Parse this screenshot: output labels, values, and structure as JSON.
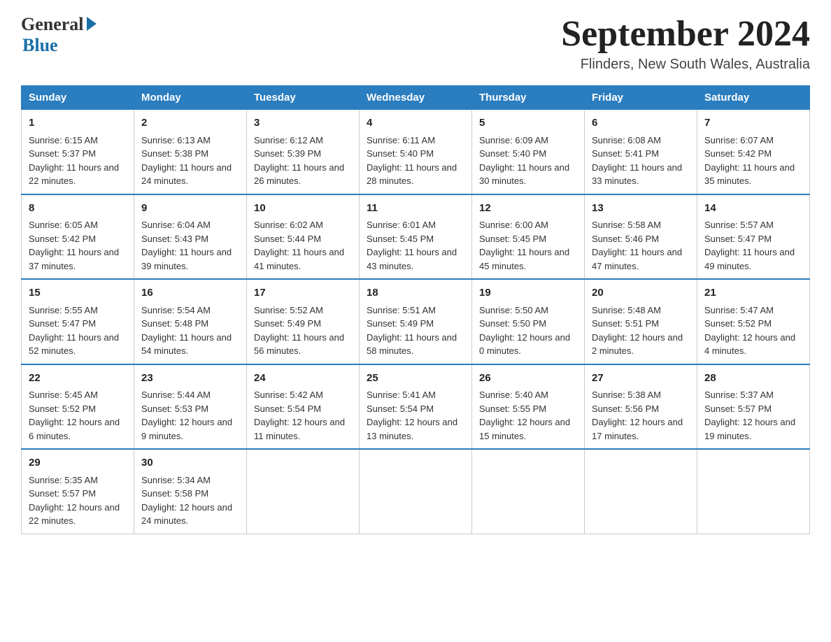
{
  "logo": {
    "general": "General",
    "blue": "Blue"
  },
  "title": {
    "month_year": "September 2024",
    "location": "Flinders, New South Wales, Australia"
  },
  "days_of_week": [
    "Sunday",
    "Monday",
    "Tuesday",
    "Wednesday",
    "Thursday",
    "Friday",
    "Saturday"
  ],
  "weeks": [
    [
      {
        "day": "1",
        "sunrise": "6:15 AM",
        "sunset": "5:37 PM",
        "daylight": "11 hours and 22 minutes."
      },
      {
        "day": "2",
        "sunrise": "6:13 AM",
        "sunset": "5:38 PM",
        "daylight": "11 hours and 24 minutes."
      },
      {
        "day": "3",
        "sunrise": "6:12 AM",
        "sunset": "5:39 PM",
        "daylight": "11 hours and 26 minutes."
      },
      {
        "day": "4",
        "sunrise": "6:11 AM",
        "sunset": "5:40 PM",
        "daylight": "11 hours and 28 minutes."
      },
      {
        "day": "5",
        "sunrise": "6:09 AM",
        "sunset": "5:40 PM",
        "daylight": "11 hours and 30 minutes."
      },
      {
        "day": "6",
        "sunrise": "6:08 AM",
        "sunset": "5:41 PM",
        "daylight": "11 hours and 33 minutes."
      },
      {
        "day": "7",
        "sunrise": "6:07 AM",
        "sunset": "5:42 PM",
        "daylight": "11 hours and 35 minutes."
      }
    ],
    [
      {
        "day": "8",
        "sunrise": "6:05 AM",
        "sunset": "5:42 PM",
        "daylight": "11 hours and 37 minutes."
      },
      {
        "day": "9",
        "sunrise": "6:04 AM",
        "sunset": "5:43 PM",
        "daylight": "11 hours and 39 minutes."
      },
      {
        "day": "10",
        "sunrise": "6:02 AM",
        "sunset": "5:44 PM",
        "daylight": "11 hours and 41 minutes."
      },
      {
        "day": "11",
        "sunrise": "6:01 AM",
        "sunset": "5:45 PM",
        "daylight": "11 hours and 43 minutes."
      },
      {
        "day": "12",
        "sunrise": "6:00 AM",
        "sunset": "5:45 PM",
        "daylight": "11 hours and 45 minutes."
      },
      {
        "day": "13",
        "sunrise": "5:58 AM",
        "sunset": "5:46 PM",
        "daylight": "11 hours and 47 minutes."
      },
      {
        "day": "14",
        "sunrise": "5:57 AM",
        "sunset": "5:47 PM",
        "daylight": "11 hours and 49 minutes."
      }
    ],
    [
      {
        "day": "15",
        "sunrise": "5:55 AM",
        "sunset": "5:47 PM",
        "daylight": "11 hours and 52 minutes."
      },
      {
        "day": "16",
        "sunrise": "5:54 AM",
        "sunset": "5:48 PM",
        "daylight": "11 hours and 54 minutes."
      },
      {
        "day": "17",
        "sunrise": "5:52 AM",
        "sunset": "5:49 PM",
        "daylight": "11 hours and 56 minutes."
      },
      {
        "day": "18",
        "sunrise": "5:51 AM",
        "sunset": "5:49 PM",
        "daylight": "11 hours and 58 minutes."
      },
      {
        "day": "19",
        "sunrise": "5:50 AM",
        "sunset": "5:50 PM",
        "daylight": "12 hours and 0 minutes."
      },
      {
        "day": "20",
        "sunrise": "5:48 AM",
        "sunset": "5:51 PM",
        "daylight": "12 hours and 2 minutes."
      },
      {
        "day": "21",
        "sunrise": "5:47 AM",
        "sunset": "5:52 PM",
        "daylight": "12 hours and 4 minutes."
      }
    ],
    [
      {
        "day": "22",
        "sunrise": "5:45 AM",
        "sunset": "5:52 PM",
        "daylight": "12 hours and 6 minutes."
      },
      {
        "day": "23",
        "sunrise": "5:44 AM",
        "sunset": "5:53 PM",
        "daylight": "12 hours and 9 minutes."
      },
      {
        "day": "24",
        "sunrise": "5:42 AM",
        "sunset": "5:54 PM",
        "daylight": "12 hours and 11 minutes."
      },
      {
        "day": "25",
        "sunrise": "5:41 AM",
        "sunset": "5:54 PM",
        "daylight": "12 hours and 13 minutes."
      },
      {
        "day": "26",
        "sunrise": "5:40 AM",
        "sunset": "5:55 PM",
        "daylight": "12 hours and 15 minutes."
      },
      {
        "day": "27",
        "sunrise": "5:38 AM",
        "sunset": "5:56 PM",
        "daylight": "12 hours and 17 minutes."
      },
      {
        "day": "28",
        "sunrise": "5:37 AM",
        "sunset": "5:57 PM",
        "daylight": "12 hours and 19 minutes."
      }
    ],
    [
      {
        "day": "29",
        "sunrise": "5:35 AM",
        "sunset": "5:57 PM",
        "daylight": "12 hours and 22 minutes."
      },
      {
        "day": "30",
        "sunrise": "5:34 AM",
        "sunset": "5:58 PM",
        "daylight": "12 hours and 24 minutes."
      },
      null,
      null,
      null,
      null,
      null
    ]
  ],
  "labels": {
    "sunrise": "Sunrise:",
    "sunset": "Sunset:",
    "daylight": "Daylight:"
  }
}
